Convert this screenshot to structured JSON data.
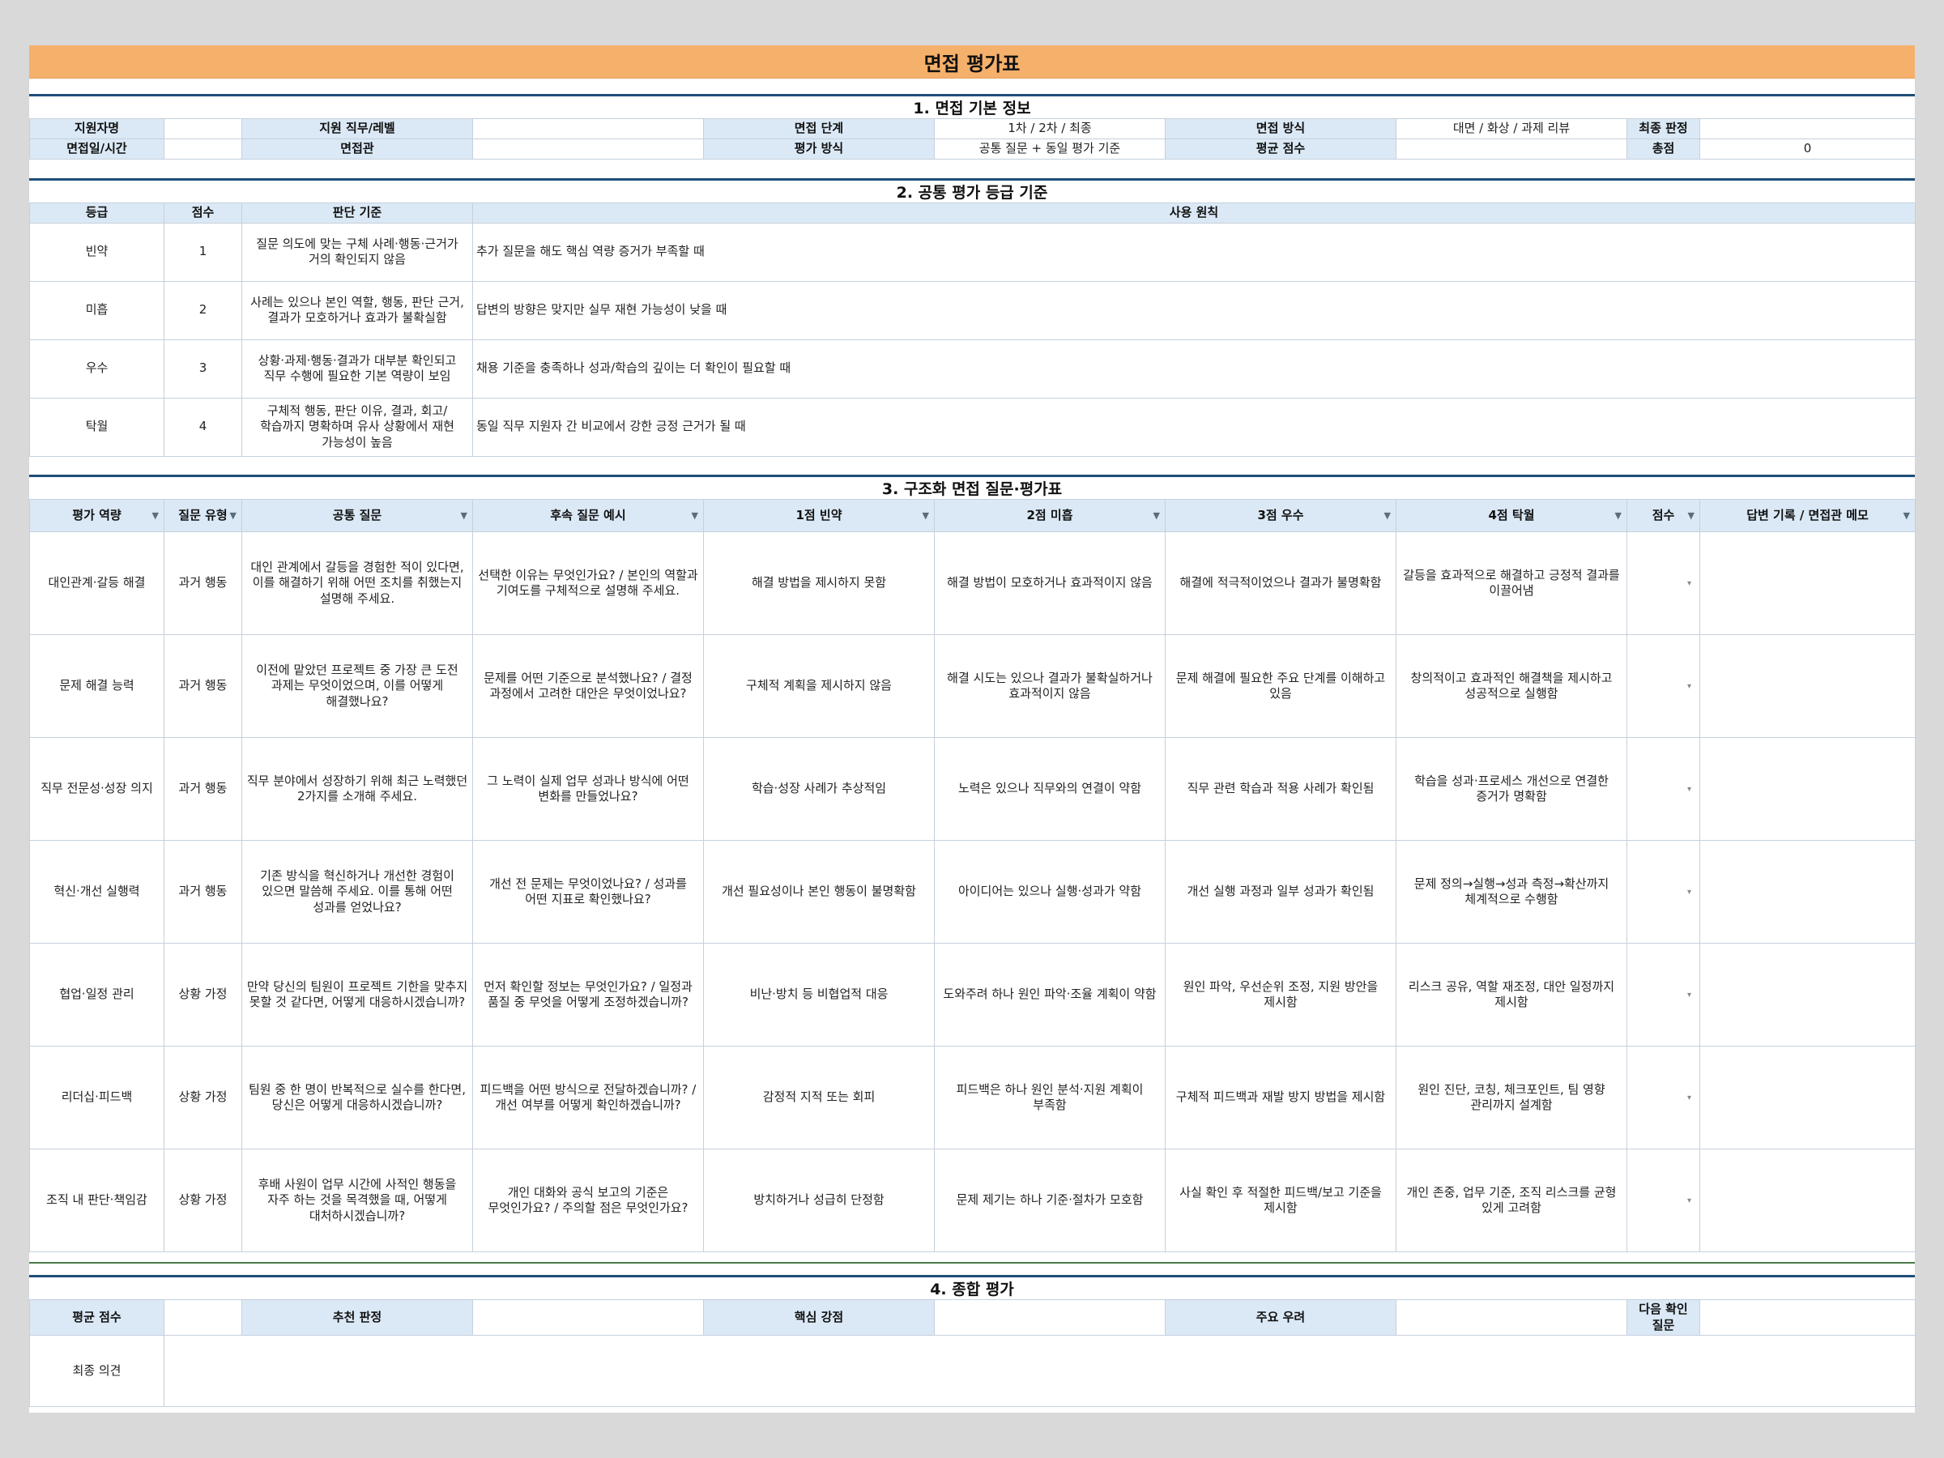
{
  "title": "면접 평가표",
  "section1": {
    "heading": "1. 면접 기본 정보",
    "row1": {
      "l1": "지원자명",
      "v1": "",
      "l2": "지원 직무/레벨",
      "v2": "",
      "l3": "면접 단계",
      "v3": "1차 / 2차 / 최종",
      "l4": "면접 방식",
      "v4": "대면 / 화상 / 과제 리뷰",
      "l5": "최종 판정",
      "v5": ""
    },
    "row2": {
      "l1": "면접일/시간",
      "v1": "",
      "l2": "면접관",
      "v2": "",
      "l3": "평가 방식",
      "v3": "공통 질문 + 동일 평가 기준",
      "l4": "평균 점수",
      "v4": "",
      "l5": "총점",
      "v5": "0"
    }
  },
  "section2": {
    "heading": "2. 공통 평가 등급 기준",
    "columns": [
      "등급",
      "점수",
      "판단 기준",
      "사용 원칙"
    ],
    "rows": [
      {
        "grade": "빈약",
        "score": "1",
        "criteria": "질문 의도에 맞는 구체 사례·행동·근거가 거의 확인되지 않음",
        "principle": "추가 질문을 해도 핵심 역량 증거가 부족할 때"
      },
      {
        "grade": "미흡",
        "score": "2",
        "criteria": "사례는 있으나 본인 역할, 행동, 판단 근거, 결과가 모호하거나 효과가 불확실함",
        "principle": "답변의 방향은 맞지만 실무 재현 가능성이 낮을 때"
      },
      {
        "grade": "우수",
        "score": "3",
        "criteria": "상황·과제·행동·결과가 대부분 확인되고 직무 수행에 필요한 기본 역량이 보임",
        "principle": "채용 기준을 충족하나 성과/학습의 깊이는 더 확인이 필요할 때"
      },
      {
        "grade": "탁월",
        "score": "4",
        "criteria": "구체적 행동, 판단 이유, 결과, 회고/학습까지 명확하며 유사 상황에서 재현 가능성이 높음",
        "principle": "동일 직무 지원자 간 비교에서 강한 긍정 근거가 될 때"
      }
    ]
  },
  "section3": {
    "heading": "3. 구조화 면접 질문·평가표",
    "columns": [
      "평가 역량",
      "질문 유형",
      "공통 질문",
      "후속 질문 예시",
      "1점 빈약",
      "2점 미흡",
      "3점 우수",
      "4점 탁월",
      "점수",
      "답변 기록 / 면접관 메모"
    ],
    "rows": [
      {
        "comp": "대인관계·갈등 해결",
        "type": "과거 행동",
        "q": "대인 관계에서 갈등을 경험한 적이 있다면, 이를 해결하기 위해 어떤 조치를 취했는지 설명해 주세요.",
        "f": "선택한 이유는 무엇인가요? / 본인의 역할과 기여도를 구체적으로 설명해 주세요.",
        "s1": "해결 방법을 제시하지 못함",
        "s2": "해결 방법이 모호하거나 효과적이지 않음",
        "s3": "해결에 적극적이었으나 결과가 불명확함",
        "s4": "갈등을 효과적으로 해결하고 긍정적 결과를 이끌어냄",
        "score": "",
        "memo": ""
      },
      {
        "comp": "문제 해결 능력",
        "type": "과거 행동",
        "q": "이전에 맡았던 프로젝트 중 가장 큰 도전 과제는 무엇이었으며, 이를 어떻게 해결했나요?",
        "f": "문제를 어떤 기준으로 분석했나요? / 결정 과정에서 고려한 대안은 무엇이었나요?",
        "s1": "구체적 계획을 제시하지 않음",
        "s2": "해결 시도는 있으나 결과가 불확실하거나 효과적이지 않음",
        "s3": "문제 해결에 필요한 주요 단계를 이해하고 있음",
        "s4": "창의적이고 효과적인 해결책을 제시하고 성공적으로 실행함",
        "score": "",
        "memo": ""
      },
      {
        "comp": "직무 전문성·성장 의지",
        "type": "과거 행동",
        "q": "직무 분야에서 성장하기 위해 최근 노력했던 2가지를 소개해 주세요.",
        "f": "그 노력이 실제 업무 성과나 방식에 어떤 변화를 만들었나요?",
        "s1": "학습·성장 사례가 추상적임",
        "s2": "노력은 있으나 직무와의 연결이 약함",
        "s3": "직무 관련 학습과 적용 사례가 확인됨",
        "s4": "학습을 성과·프로세스 개선으로 연결한 증거가 명확함",
        "score": "",
        "memo": ""
      },
      {
        "comp": "혁신·개선 실행력",
        "type": "과거 행동",
        "q": "기존 방식을 혁신하거나 개선한 경험이 있으면 말씀해 주세요. 이를 통해 어떤 성과를 얻었나요?",
        "f": "개선 전 문제는 무엇이었나요? / 성과를 어떤 지표로 확인했나요?",
        "s1": "개선 필요성이나 본인 행동이 불명확함",
        "s2": "아이디어는 있으나 실행·성과가 약함",
        "s3": "개선 실행 과정과 일부 성과가 확인됨",
        "s4": "문제 정의→실행→성과 측정→확산까지 체계적으로 수행함",
        "score": "",
        "memo": ""
      },
      {
        "comp": "협업·일정 관리",
        "type": "상황 가정",
        "q": "만약 당신의 팀원이 프로젝트 기한을 맞추지 못할 것 같다면, 어떻게 대응하시겠습니까?",
        "f": "먼저 확인할 정보는 무엇인가요? / 일정과 품질 중 무엇을 어떻게 조정하겠습니까?",
        "s1": "비난·방치 등 비협업적 대응",
        "s2": "도와주려 하나 원인 파악·조율 계획이 약함",
        "s3": "원인 파악, 우선순위 조정, 지원 방안을 제시함",
        "s4": "리스크 공유, 역할 재조정, 대안 일정까지 제시함",
        "score": "",
        "memo": ""
      },
      {
        "comp": "리더십·피드백",
        "type": "상황 가정",
        "q": "팀원 중 한 명이 반복적으로 실수를 한다면, 당신은 어떻게 대응하시겠습니까?",
        "f": "피드백을 어떤 방식으로 전달하겠습니까? / 개선 여부를 어떻게 확인하겠습니까?",
        "s1": "감정적 지적 또는 회피",
        "s2": "피드백은 하나 원인 분석·지원 계획이 부족함",
        "s3": "구체적 피드백과 재발 방지 방법을 제시함",
        "s4": "원인 진단, 코칭, 체크포인트, 팀 영향 관리까지 설계함",
        "score": "",
        "memo": ""
      },
      {
        "comp": "조직 내 판단·책임감",
        "type": "상황 가정",
        "q": "후배 사원이 업무 시간에 사적인 행동을 자주 하는 것을 목격했을 때, 어떻게 대처하시겠습니까?",
        "f": "개인 대화와 공식 보고의 기준은 무엇인가요? / 주의할 점은 무엇인가요?",
        "s1": "방치하거나 성급히 단정함",
        "s2": "문제 제기는 하나 기준·절차가 모호함",
        "s3": "사실 확인 후 적절한 피드백/보고 기준을 제시함",
        "s4": "개인 존중, 업무 기준, 조직 리스크를 균형 있게 고려함",
        "score": "",
        "memo": ""
      }
    ]
  },
  "section4": {
    "heading": "4. 종합 평가",
    "labels": {
      "avg": "평균 점수",
      "rec": "추천 판정",
      "core": "핵심 강점",
      "concern": "주요 우려",
      "next": "다음 확인 질문",
      "final": "최종 의견"
    },
    "values": {
      "avg": "",
      "rec": "",
      "core": "",
      "concern": "",
      "next": "",
      "final": ""
    }
  },
  "icons": {
    "filter": "filter-dropdown-icon",
    "dropdown": "dropdown-arrow-icon"
  },
  "colors": {
    "title_bg": "#f5b06b",
    "label_bg": "#dbe9f6",
    "section_rule": "#1f4e79"
  }
}
